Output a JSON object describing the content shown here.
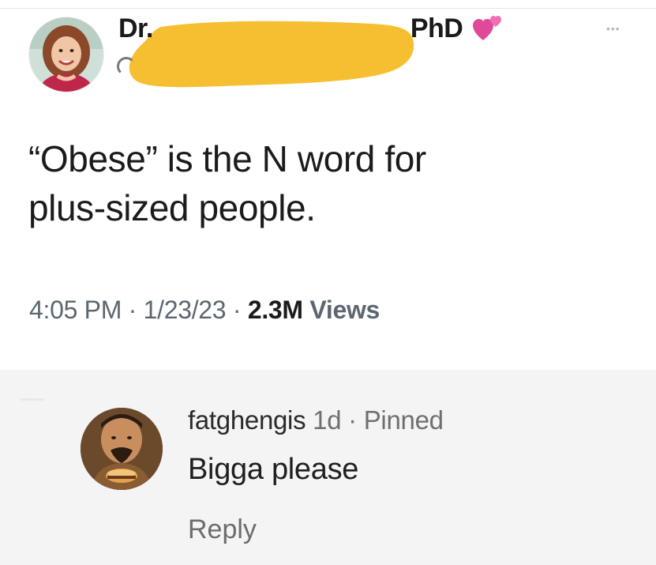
{
  "tweet": {
    "display_name_prefix": "Dr.",
    "display_name_suffix": "PhD",
    "text": "“Obese” is the N word for\nplus-sized people.",
    "time": "4:05 PM",
    "date": "1/23/23",
    "views_count": "2.3M",
    "views_label": "Views",
    "separator": " · ",
    "icons": {
      "heart": "two-hearts-icon",
      "more": "more-options-icon",
      "avatar": "avatar-photo"
    },
    "colors": {
      "redaction": "#f6bf31",
      "heart": "#e0489a",
      "meta_text": "#5b6670"
    }
  },
  "comment": {
    "username": "fatghengis",
    "age": "1d",
    "pinned_label": "Pinned",
    "separator": " · ",
    "text": "Bigga please",
    "reply_label": "Reply"
  }
}
